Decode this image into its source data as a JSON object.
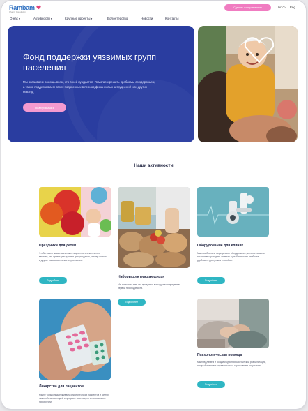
{
  "header": {
    "logo": "Rambam",
    "logo_sub": "Charity Foundation",
    "donate_label": "Сделать пожертвование",
    "lang_he": "עברית",
    "lang_en": "Eng"
  },
  "nav": {
    "items": [
      {
        "label": "О нас",
        "dropdown": true
      },
      {
        "label": "Активности",
        "dropdown": true
      },
      {
        "label": "Крупные проекты",
        "dropdown": true
      },
      {
        "label": "Волонтерство",
        "dropdown": false
      },
      {
        "label": "Новости",
        "dropdown": false
      },
      {
        "label": "Контакты",
        "dropdown": false
      }
    ]
  },
  "hero": {
    "title": "Фонд поддержки уязвимых групп населения",
    "text": "Мы оказываем помощь всем, кто в ней нуждается. Помогаем решать проблемы со здоровьем, а также поддерживаем своих подопечных в период финансовых затруднений или других невзгод",
    "button": "Пожертвовать"
  },
  "activities": {
    "title": "Наши активности",
    "more_label": "Подробнее",
    "cards": [
      {
        "title": "Праздники для детей",
        "text": "Чтобы жизнь наших маленьких пациентов стала немного веселее, мы организуем для них дни рождения, мастер-классы и другие развлекательные мероприятия."
      },
      {
        "title": "Наборы для нуждающихся",
        "text": "Мы помогаем тем, кто нуждается в продуктах и предметах первой необходимости."
      },
      {
        "title": "Оборудование для клиник",
        "text": "Мы приобретаем медицинское оборудование, которое помогает пациентам проходить лечение и реабилитацию наиболее удобным и доступным способом."
      },
      {
        "title": "Лекарства для пациентов",
        "text": "Мы не только поддерживаем онкологических пациентов и других тяжелобольных людей в процессе лечения, но и помогаем им приобрести"
      },
      {
        "title": "Психологическая помощь",
        "text": "Мы предлагаем и создаем курс психологической реабилитации, который помогает справляться со стрессовыми ситуациями."
      }
    ]
  }
}
